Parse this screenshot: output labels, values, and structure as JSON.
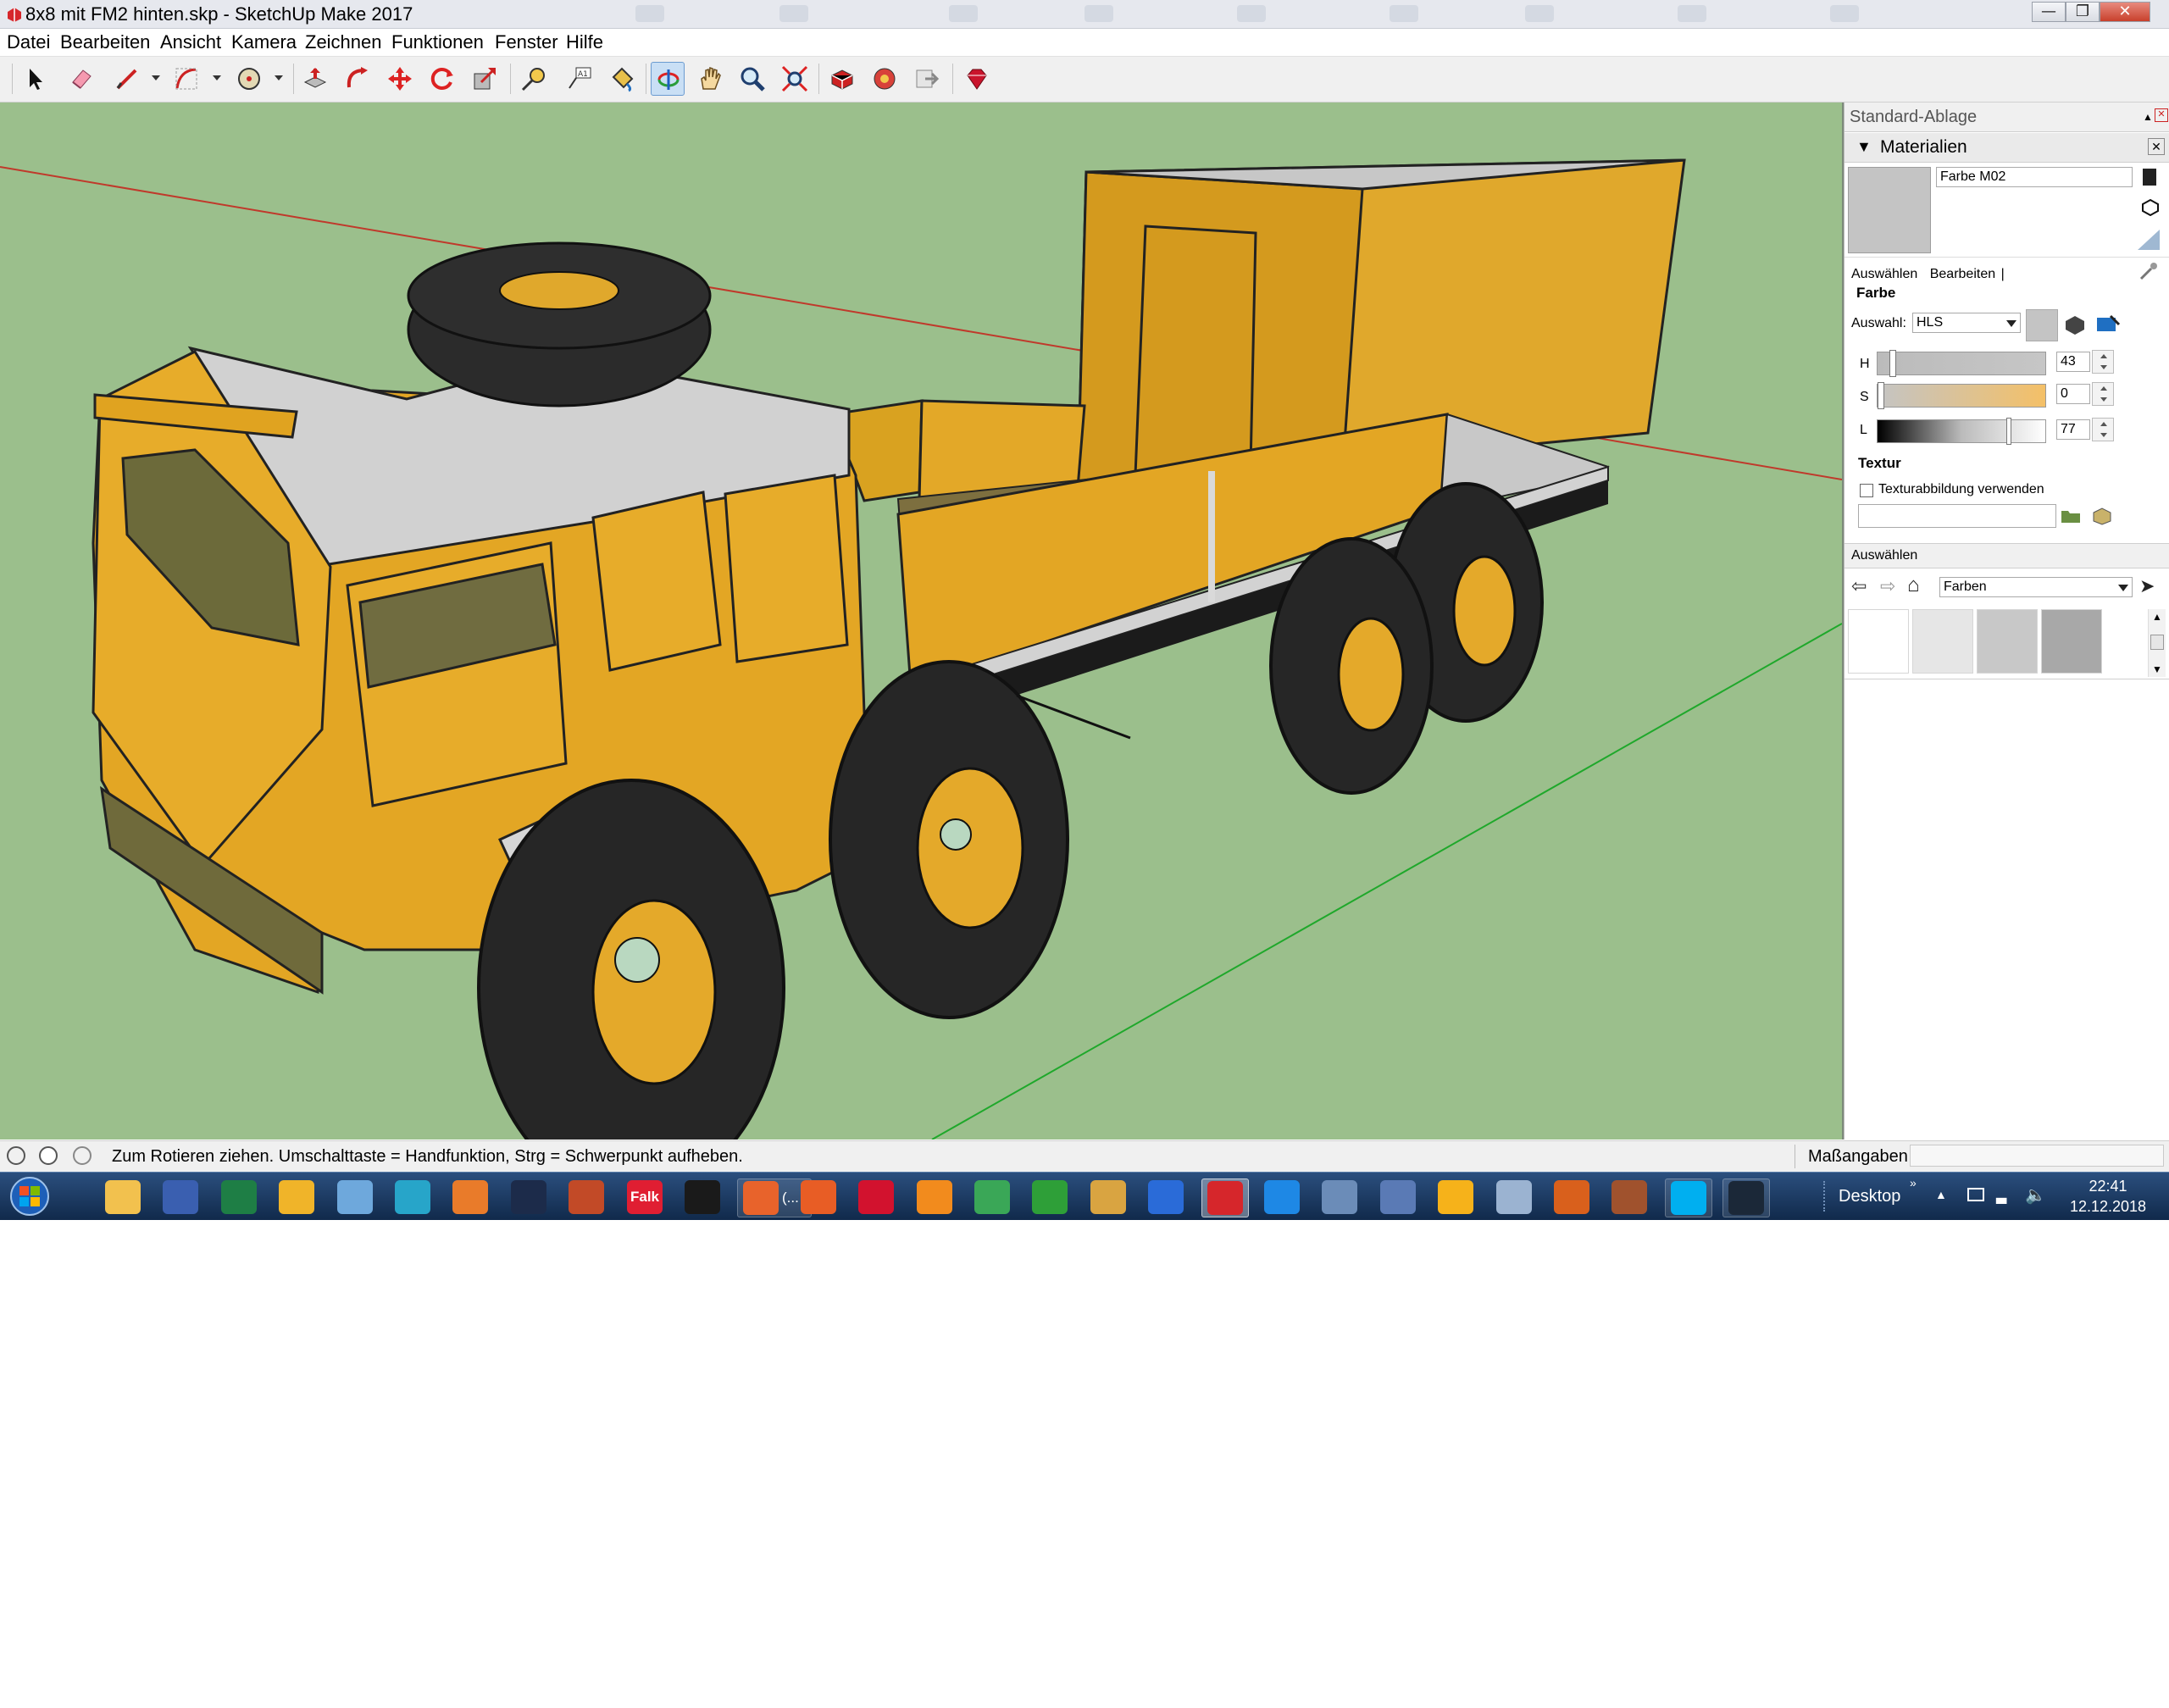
{
  "window": {
    "title": "8x8 mit FM2 hinten.skp - SketchUp Make 2017",
    "buttons": [
      "minimize",
      "maximize",
      "close"
    ]
  },
  "menu": [
    "Datei",
    "Bearbeiten",
    "Ansicht",
    "Kamera",
    "Zeichnen",
    "Funktionen",
    "Fenster",
    "Hilfe"
  ],
  "toolbar": {
    "tools": [
      {
        "name": "select-tool-icon"
      },
      {
        "name": "eraser-tool-icon"
      },
      {
        "name": "line-tool-icon"
      },
      {
        "name": "arc-tool-icon"
      },
      {
        "name": "circle-tool-icon"
      },
      {
        "name": "push-pull-tool-icon"
      },
      {
        "name": "follow-me-tool-icon"
      },
      {
        "name": "move-tool-icon"
      },
      {
        "name": "rotate-tool-icon"
      },
      {
        "name": "scale-tool-icon"
      },
      {
        "name": "tape-measure-tool-icon"
      },
      {
        "name": "text-tool-icon"
      },
      {
        "name": "paint-bucket-tool-icon"
      },
      {
        "name": "orbit-tool-icon",
        "active": true
      },
      {
        "name": "pan-tool-icon"
      },
      {
        "name": "zoom-tool-icon"
      },
      {
        "name": "zoom-extents-tool-icon"
      },
      {
        "name": "3d-warehouse-icon"
      },
      {
        "name": "extension-warehouse-icon"
      },
      {
        "name": "send-to-layout-icon"
      },
      {
        "name": "ruby-extension-icon"
      }
    ]
  },
  "tray": {
    "title": "Standard-Ablage",
    "materials": {
      "title": "Materialien",
      "material_name": "Farbe M02",
      "tabs": [
        "Auswählen",
        "Bearbeiten"
      ],
      "color_section": "Farbe",
      "picker_label": "Auswahl:",
      "picker_value": "HLS",
      "sliders": [
        {
          "label": "H",
          "value": "43"
        },
        {
          "label": "S",
          "value": "0"
        },
        {
          "label": "L",
          "value": "77"
        }
      ],
      "texture_section": "Textur",
      "texture_checkbox": "Texturabbildung verwenden",
      "texture_path": ""
    },
    "select_panel": {
      "title": "Auswählen",
      "library": "Farben",
      "swatches": [
        "#ffffff",
        "#e6e6e6",
        "#c8c8c8",
        "#a8a8a8"
      ]
    }
  },
  "status": {
    "message": "Zum Rotieren ziehen. Umschalttaste = Handfunktion, Strg = Schwerpunkt aufheben.",
    "measurements_label": "Maßangaben",
    "measurements_value": ""
  },
  "taskbar": {
    "items": [
      {
        "name": "explorer-icon",
        "color": "#f2c14e"
      },
      {
        "name": "save-icon",
        "color": "#3a5fb0"
      },
      {
        "name": "excel-icon",
        "color": "#1e7e45"
      },
      {
        "name": "outlook-icon",
        "color": "#f0b429"
      },
      {
        "name": "notes-icon",
        "color": "#6ea8dc"
      },
      {
        "name": "globe-icon",
        "color": "#27a5c9"
      },
      {
        "name": "viewer-icon",
        "color": "#e97b2a"
      },
      {
        "name": "media-icon",
        "color": "#1c2b4a"
      },
      {
        "name": "burner-icon",
        "color": "#c24a27"
      },
      {
        "name": "falk-icon",
        "color": "#e01e32",
        "label": "Falk"
      },
      {
        "name": "mcdonalds-icon",
        "color": "#1a1a1a"
      },
      {
        "name": "firefox-icon",
        "color": "#e8632b",
        "label": "(...",
        "open": true
      },
      {
        "name": "sphere-icon",
        "color": "#e85d25"
      },
      {
        "name": "opera-icon",
        "color": "#d2122e"
      },
      {
        "name": "player-icon",
        "color": "#f28b1d"
      },
      {
        "name": "chrome-icon",
        "color": "#3aa757"
      },
      {
        "name": "puzzle-icon",
        "color": "#2e9f38"
      },
      {
        "name": "palette-icon",
        "color": "#d9a441"
      },
      {
        "name": "dropbox-icon",
        "color": "#2a6bd8"
      },
      {
        "name": "sketchup-icon",
        "color": "#d6262b",
        "active": true
      },
      {
        "name": "ie-icon",
        "color": "#1e88e5"
      },
      {
        "name": "calculator-icon",
        "color": "#6b8cb8"
      },
      {
        "name": "control-panel-icon",
        "color": "#5a7ab5"
      },
      {
        "name": "mailbird-icon",
        "color": "#f6b21a"
      },
      {
        "name": "backup-icon",
        "color": "#9bb3d1"
      },
      {
        "name": "game-icon",
        "color": "#d9601c"
      },
      {
        "name": "avatar-icon",
        "color": "#a0522d"
      },
      {
        "name": "skype-icon",
        "color": "#00aff0",
        "open": true
      },
      {
        "name": "steam-icon",
        "color": "#1b2838",
        "open": true
      }
    ],
    "desktop_label": "Desktop",
    "time": "22:41",
    "date": "12.12.2018"
  }
}
